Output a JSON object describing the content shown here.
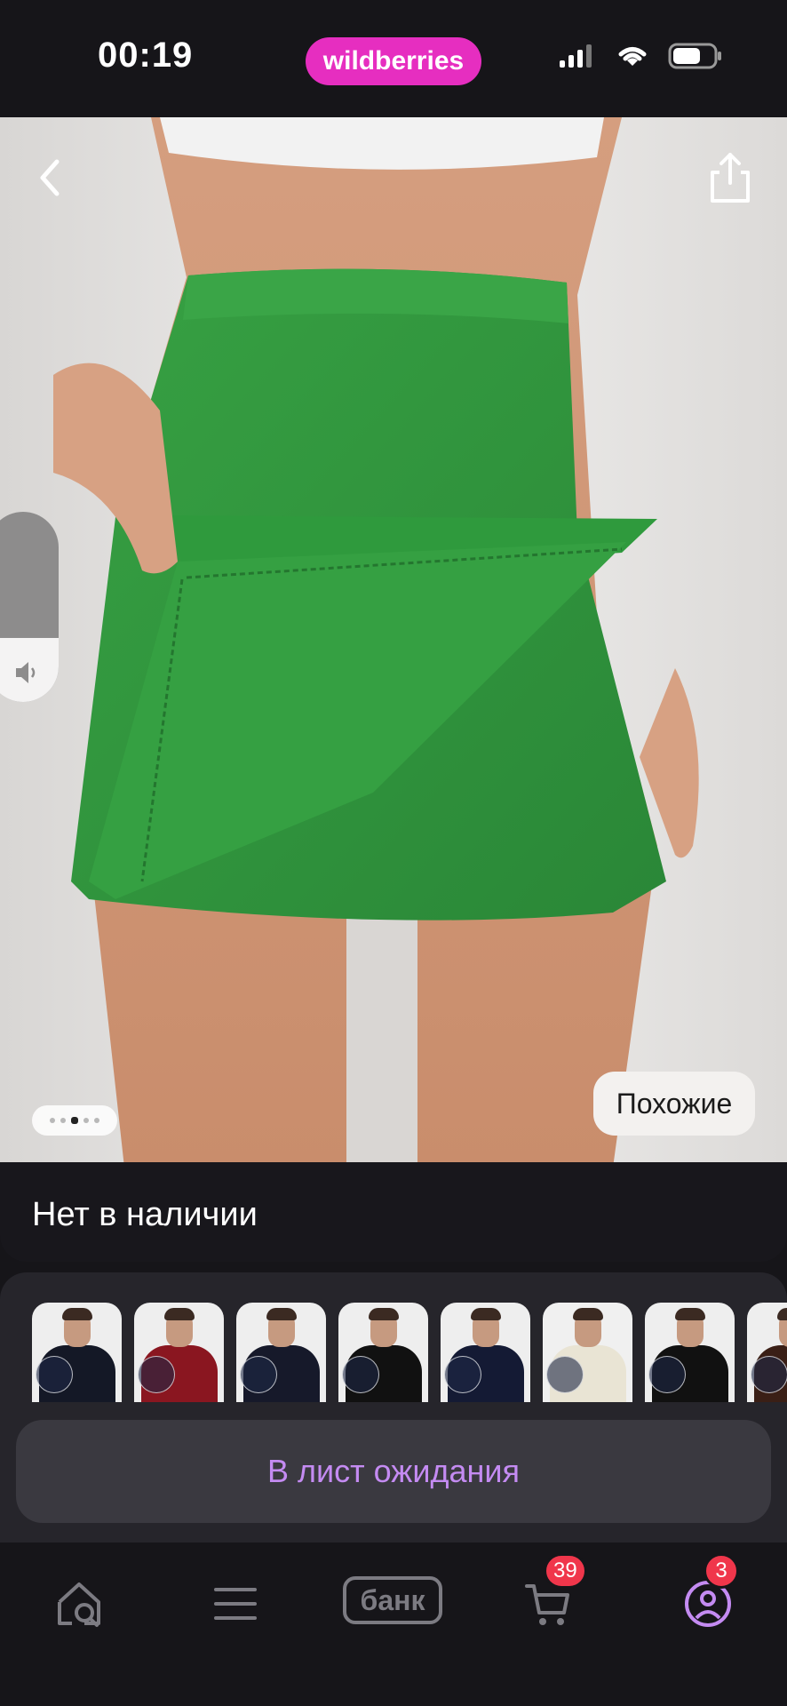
{
  "status_bar": {
    "time": "00:19",
    "brand": "wildberries",
    "icons": [
      "signal-icon",
      "wifi-icon",
      "battery-icon"
    ]
  },
  "product": {
    "image_description": "green skort photo",
    "gallery_dots": 5,
    "gallery_active_index": 2,
    "similar_label": "Похожие",
    "volume_level": 0.35
  },
  "availability": {
    "text": "Нет в наличии"
  },
  "variants": {
    "shirt_colors": [
      "#141826",
      "#8a1620",
      "#16192a",
      "#111111",
      "#141a34",
      "#e9e4d4",
      "#111111",
      "#3a1f16"
    ]
  },
  "actions": {
    "wait_list_label": "В лист ожидания"
  },
  "tab_bar": {
    "items": [
      "home-search-icon",
      "menu-icon",
      "bank-icon",
      "cart-icon",
      "profile-icon"
    ],
    "bank_label": "банк",
    "cart_count": "39",
    "profile_count": "3"
  },
  "colors": {
    "background": "#161519",
    "brand_pink": "#e62ec0",
    "accent_purple": "#c48bf2",
    "badge_red": "#f0364b",
    "product_green": "#2f8f3c"
  }
}
